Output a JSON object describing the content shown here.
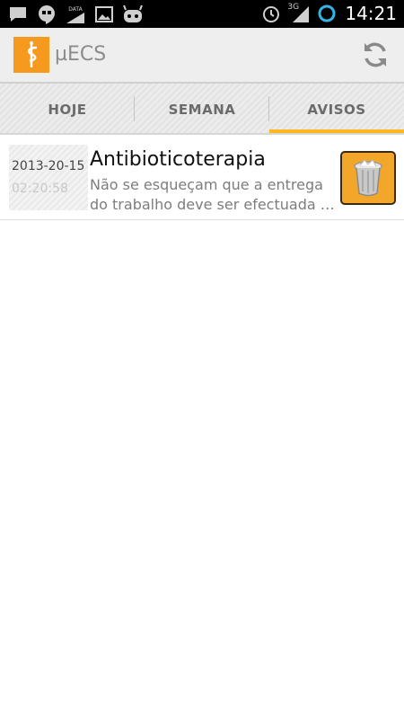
{
  "status_bar": {
    "left_icons": [
      "chat-icon",
      "hangouts-icon",
      "data-icon",
      "image-icon",
      "cyanogen-icon"
    ],
    "right_icons": [
      "alarm-icon",
      "signal-icon",
      "ring-icon"
    ],
    "network": "3G",
    "data_label": "DATA",
    "time": "14:21"
  },
  "action_bar": {
    "app_title": "µECS",
    "app_icon": "caduceus-icon",
    "refresh_icon": "refresh-icon"
  },
  "tabs": [
    {
      "label": "HOJE",
      "active": false
    },
    {
      "label": "SEMANA",
      "active": false
    },
    {
      "label": "AVISOS",
      "active": true
    }
  ],
  "colors": {
    "accent": "#fbb820",
    "app_icon": "#f59a1e",
    "delete_button": "#f2a72a"
  },
  "notices": [
    {
      "date": "2013-20-15",
      "time": "02:20:58",
      "title": "Antibioticoterapia",
      "desc_line1": "Não se esqueçam que a entrega",
      "desc_line2": "do trabalho deve ser efectuada at…",
      "action_icon": "trash-can-icon"
    }
  ]
}
